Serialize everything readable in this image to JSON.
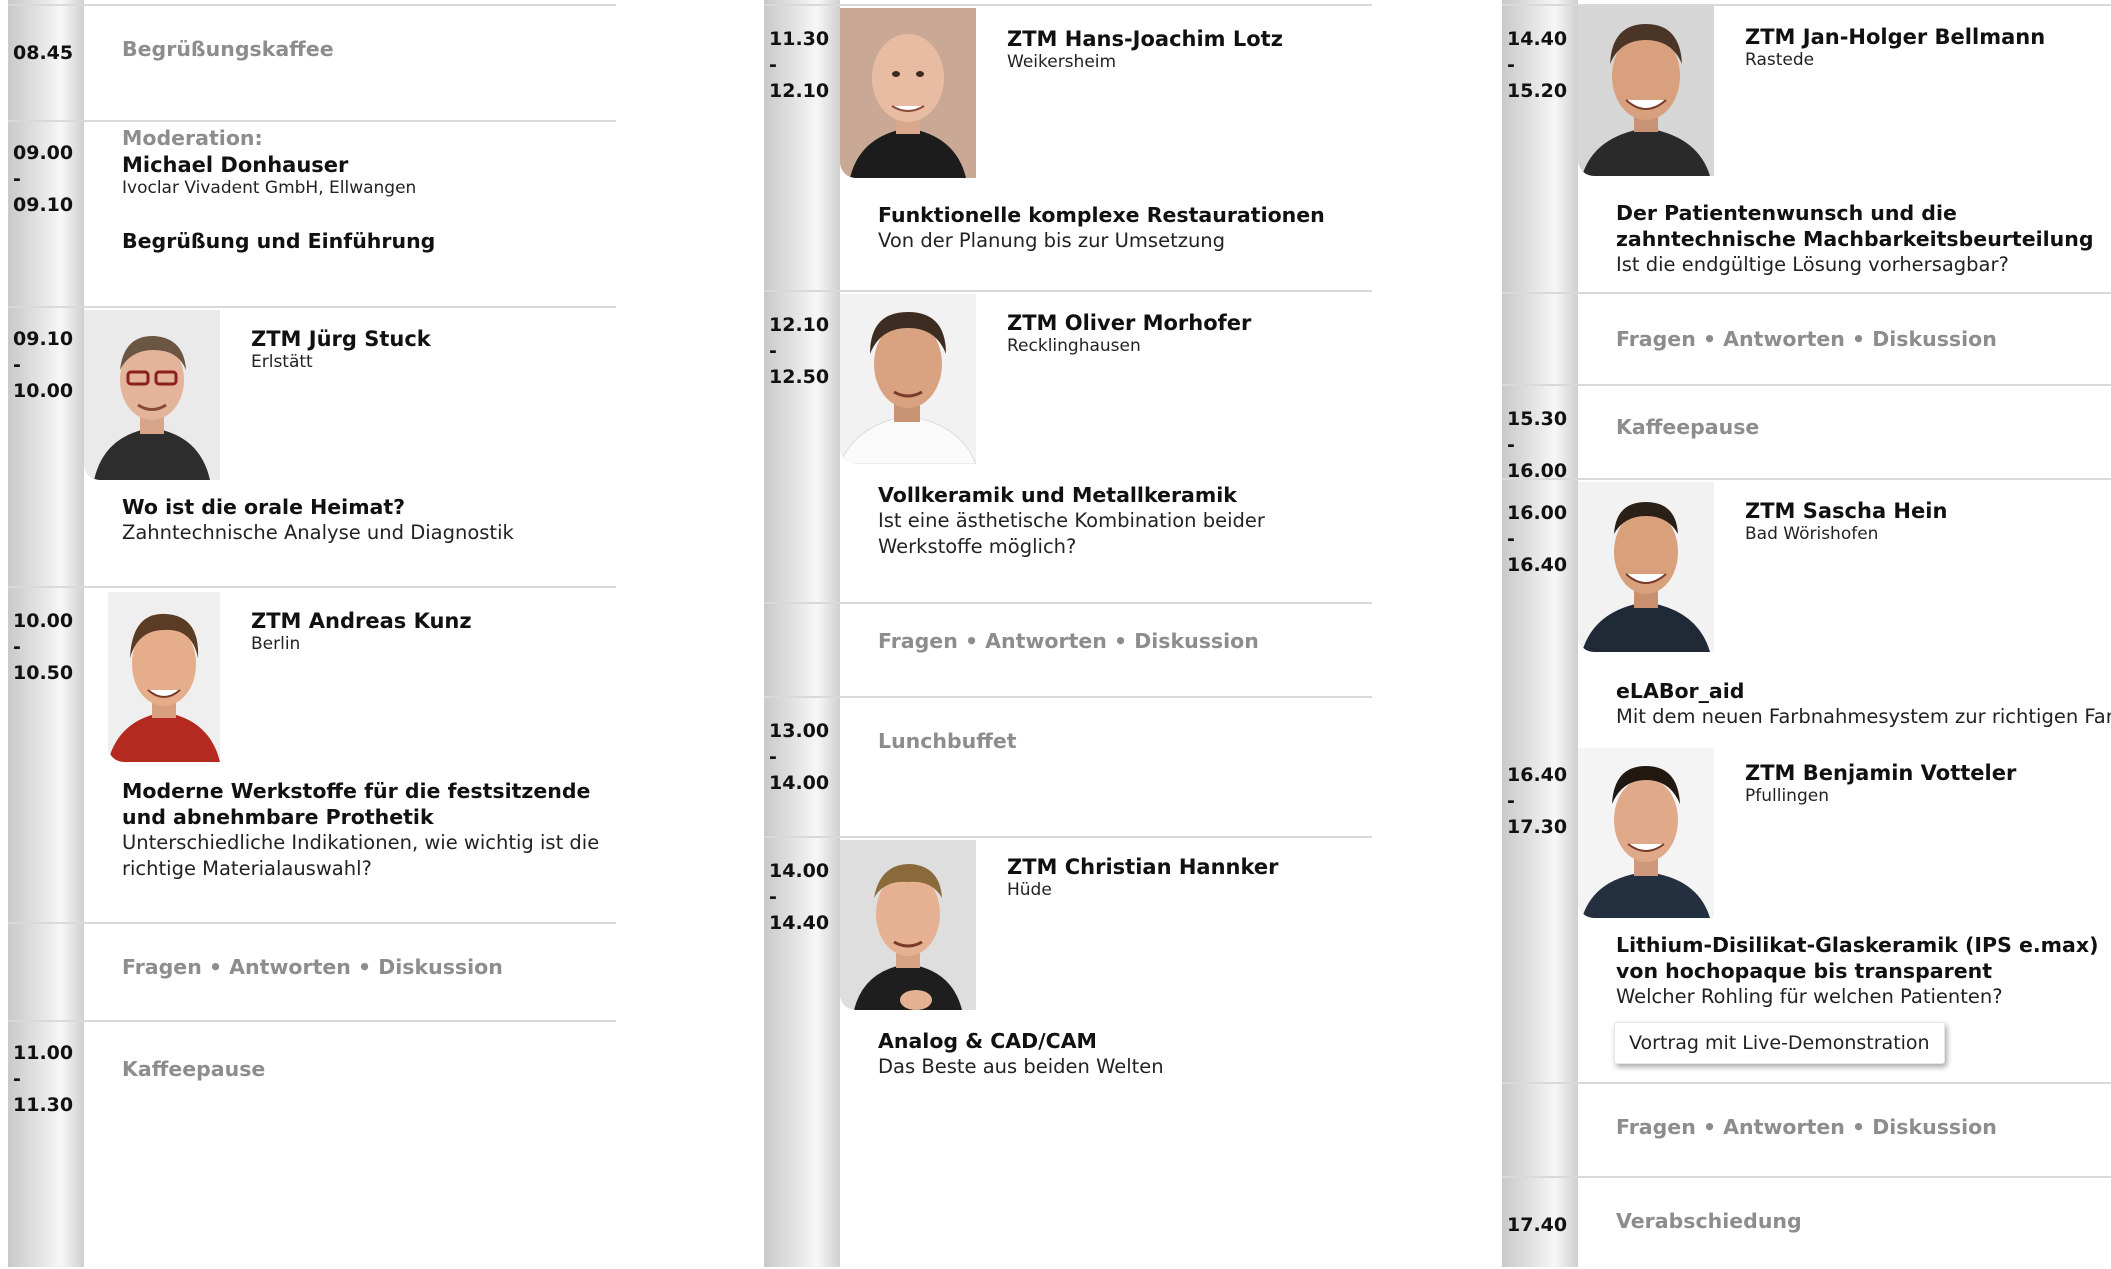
{
  "col1": {
    "b1": {
      "time": "08.45",
      "label": "Begrüßungskaffee"
    },
    "b2": {
      "time": "09.00 - 09.10",
      "mod_label": "Moderation:",
      "name": "Michael Donhauser",
      "org": "Ivoclar Vivadent GmbH, Ellwangen",
      "title": "Begrüßung und Einführung"
    },
    "b3": {
      "time": "09.10 - 10.00",
      "name": "ZTM Jürg Stuck",
      "place": "Erlstätt",
      "title": "Wo ist die orale Heimat?",
      "sub": "Zahntechnische Analyse und Diagnostik"
    },
    "b4": {
      "time": "10.00 - 10.50",
      "name": "ZTM Andreas Kunz",
      "place": "Berlin",
      "title": "Moderne Werkstoffe für die festsitzende und abnehmbare Prothetik",
      "sub": "Unterschiedliche Indikationen, wie wichtig ist die richtige Materialauswahl?"
    },
    "b5": {
      "label": "Fragen • Antworten • Diskussion"
    },
    "b6": {
      "time": "11.00 - 11.30",
      "label": "Kaffeepause"
    }
  },
  "col2": {
    "b1": {
      "time": "11.30 - 12.10",
      "name": "ZTM Hans-Joachim Lotz",
      "place": "Weikersheim",
      "title": "Funktionelle komplexe Restaurationen",
      "sub": "Von der Planung bis zur Umsetzung"
    },
    "b2": {
      "time": "12.10 - 12.50",
      "name": "ZTM Oliver Morhofer",
      "place": "Recklinghausen",
      "title": "Vollkeramik und Metallkeramik",
      "sub": "Ist eine ästhetische Kombination beider Werkstoffe möglich?"
    },
    "b3": {
      "label": "Fragen • Antworten • Diskussion"
    },
    "b4": {
      "time": "13.00 - 14.00",
      "label": "Lunchbuffet"
    },
    "b5": {
      "time": "14.00 - 14.40",
      "name": "ZTM Christian Hannker",
      "place": "Hüde",
      "title": "Analog & CAD/CAM",
      "sub": "Das Beste aus beiden Welten"
    }
  },
  "col3": {
    "b1": {
      "time": "14.40 - 15.20",
      "name": "ZTM Jan-Holger Bellmann",
      "place": "Rastede",
      "title": "Der Patientenwunsch und die zahntechnische Machbarkeitsbeurteilung",
      "sub": "Ist die endgültige Lösung vorhersagbar?"
    },
    "b2": {
      "label": "Fragen • Antworten • Diskussion"
    },
    "b3": {
      "time": "15.30 - 16.00",
      "label": "Kaffeepause"
    },
    "b4": {
      "time": "16.00 - 16.40",
      "name": "ZTM Sascha Hein",
      "place": "Bad Wörishofen",
      "title": "eLABor_aid",
      "sub": "Mit dem neuen Farbnahmesystem zur richtigen Farbe"
    },
    "b5": {
      "time": "16.40 - 17.30",
      "name": "ZTM Benjamin Votteler",
      "place": "Pfullingen",
      "title": "Lithium-Disilikat-Glaskeramik (IPS e.max) von hochopaque bis transparent",
      "sub": "Welcher Rohling für welchen Patienten?",
      "badge": "Vortrag mit Live-Demonstration"
    },
    "b6": {
      "label": "Fragen • Antworten • Diskussion"
    },
    "b7": {
      "time": "17.40",
      "label": "Verabschiedung"
    }
  },
  "icons": {
    "portrait": "speaker-portrait-photo"
  },
  "colors": {
    "strip": "#d4d4d4",
    "rule": "#d9d9d9",
    "grey_text": "#8d8d8d"
  }
}
